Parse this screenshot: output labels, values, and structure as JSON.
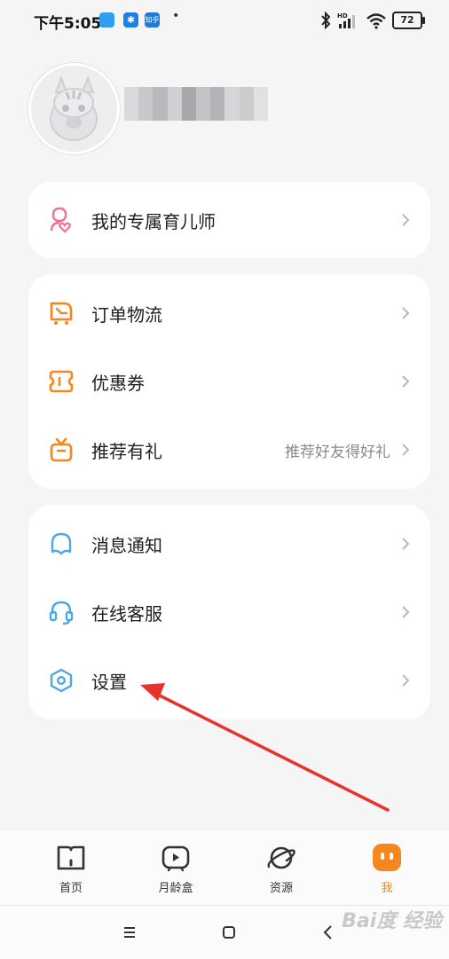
{
  "status_bar": {
    "time": "下午5:05",
    "battery": "72",
    "app_icons": [
      "qq-browser-icon",
      "bluetooth-app-icon",
      "zhihu-icon"
    ],
    "zhihu_text": "知乎"
  },
  "profile": {
    "avatar_icon": "zebra-avatar-icon"
  },
  "menu": {
    "advisor": {
      "label": "我的专属育儿师",
      "icon": "advisor-heart-icon"
    },
    "orders": {
      "label": "订单物流",
      "icon": "truck-icon"
    },
    "coupons": {
      "label": "优惠券",
      "icon": "coupon-icon"
    },
    "referral": {
      "label": "推荐有礼",
      "hint": "推荐好友得好礼",
      "icon": "gift-icon"
    },
    "notifications": {
      "label": "消息通知",
      "icon": "bell-icon"
    },
    "support": {
      "label": "在线客服",
      "icon": "headset-icon"
    },
    "settings": {
      "label": "设置",
      "icon": "hexagon-settings-icon"
    }
  },
  "tabs": [
    {
      "label": "首页",
      "icon": "home-book-icon",
      "active": false
    },
    {
      "label": "月龄盒",
      "icon": "play-tv-icon",
      "active": false
    },
    {
      "label": "资源",
      "icon": "planet-icon",
      "active": false
    },
    {
      "label": "我",
      "icon": "me-face-icon",
      "active": true
    }
  ],
  "colors": {
    "accent_orange": "#f7861f",
    "pink": "#f2708f",
    "blue": "#4aa8e8",
    "arrow_red": "#e8332a"
  },
  "watermark": "Bai度 经验"
}
